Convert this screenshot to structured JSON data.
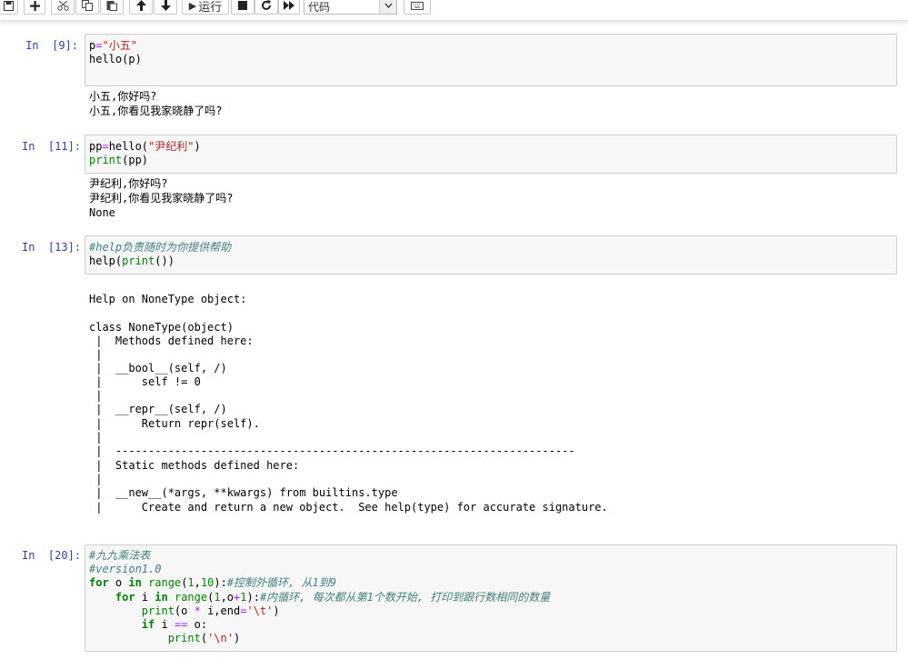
{
  "toolbar": {
    "run_label": "运行",
    "cell_type": "代码",
    "icons": [
      "save-icon",
      "plus-icon",
      "cut-icon",
      "copy-icon",
      "paste-icon",
      "arrow-up-icon",
      "arrow-down-icon",
      "run-icon",
      "stop-icon",
      "restart-icon",
      "fast-forward-icon",
      "keyboard-icon"
    ]
  },
  "cells": [
    {
      "prompt": "In  [9]:",
      "code": [
        "p=\"小五\"",
        "hello(p)"
      ],
      "output": [
        "小五,你好吗?",
        "小五,你看见我家晓静了吗?"
      ]
    },
    {
      "prompt": "In  [11]:",
      "code": [
        "pp=hello(\"尹纪利\")",
        "print(pp)"
      ],
      "output": [
        "尹纪利,你好吗?",
        "尹纪利,你看见我家晓静了吗?",
        "None"
      ]
    },
    {
      "prompt": "In  [13]:",
      "code": [
        "#help负责随时为你提供帮助",
        "help(print())"
      ],
      "output": [
        "Help on NoneType object:",
        "",
        "class NoneType(object)",
        " |  Methods defined here:",
        " |",
        " |  __bool__(self, /)",
        " |      self != 0",
        " |",
        " |  __repr__(self, /)",
        " |      Return repr(self).",
        " |",
        " |  ----------------------------------------------------------------------",
        " |  Static methods defined here:",
        " |",
        " |  __new__(*args, **kwargs) from builtins.type",
        " |      Create and return a new object.  See help(type) for accurate signature."
      ]
    },
    {
      "prompt": "In  [20]:",
      "code": [
        "#九九乘法表",
        "#version1.0",
        "for o in range(1,10):#控制外循环, 从1到9",
        "    for i in range(1,o+1):#内循环, 每次都从第1个数开始, 打印到跟行数相同的数量",
        "        print(o * i,end='\\t')",
        "        if i == o:",
        "            print('\\n')"
      ]
    }
  ]
}
